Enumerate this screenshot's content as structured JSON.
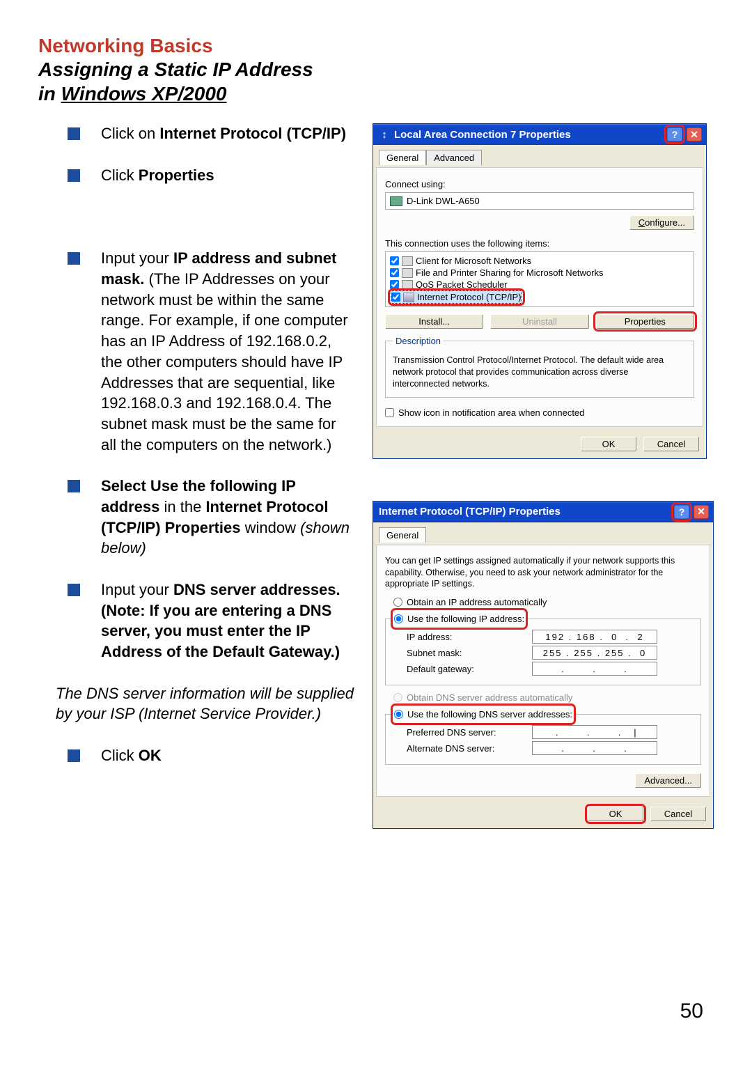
{
  "headings": {
    "red": "Networking Basics",
    "black_line1": "Assigning a Static IP Address",
    "black_line2_prefix": "in ",
    "black_line2_underlined": "Windows XP/2000"
  },
  "instructions": {
    "i1_a": "Click on ",
    "i1_b": "Internet Protocol (TCP/IP)",
    "i2_a": "Click ",
    "i2_b": "Properties",
    "i3_a": "Input your ",
    "i3_b": "IP address and subnet mask.",
    "i3_c": " (The IP Addresses on your network must be within the same range. For example, if one computer has an IP Address of 192.168.0.2, the other computers should have IP Addresses that are sequential, like 192.168.0.3 and 192.168.0.4. The subnet mask must be the same for all the computers on the network.)",
    "i4_a": "Select Use the following IP address",
    "i4_b": "  in the ",
    "i4_c": "Internet Protocol (TCP/IP) Properties",
    "i4_d": " window ",
    "i4_e": "(shown below)",
    "i5_a": "Input your ",
    "i5_b": "DNS server addresses. (Note:  If you are entering a DNS server, you must enter the IP Address of the Default Gateway.)",
    "i6_a": "Click ",
    "i6_b": "OK"
  },
  "isp_note": "The DNS server information will be supplied by your ISP (Internet Service Provider.)",
  "page_number": "50",
  "dialog1": {
    "title": "Local Area Connection 7 Properties",
    "tabs": [
      "General",
      "Advanced"
    ],
    "connect_using_label": "Connect using:",
    "adapter": "D-Link DWL-A650",
    "configure_btn": "Configure...",
    "items_label": "This connection uses the following items:",
    "items": [
      "Client for Microsoft Networks",
      "File and Printer Sharing for Microsoft Networks",
      "QoS Packet Scheduler",
      "Internet Protocol (TCP/IP)"
    ],
    "install_btn": "Install...",
    "uninstall_btn": "Uninstall",
    "properties_btn": "Properties",
    "desc_legend": "Description",
    "desc_text": "Transmission Control Protocol/Internet Protocol. The default wide area network protocol that provides communication across diverse interconnected networks.",
    "show_icon": "Show icon in notification area when connected",
    "ok": "OK",
    "cancel": "Cancel"
  },
  "dialog2": {
    "title": "Internet Protocol (TCP/IP) Properties",
    "tab": "General",
    "note": "You can get IP settings assigned automatically if your network supports this capability. Otherwise, you need to ask your network administrator for the appropriate IP settings.",
    "r_obtain_ip": "Obtain an IP address automatically",
    "r_use_ip": "Use the following IP address:",
    "ip_label": "IP address:",
    "ip_value": "192 . 168 .  0  .  2",
    "subnet_label": "Subnet mask:",
    "subnet_value": "255 . 255 . 255 .  0",
    "gateway_label": "Default gateway:",
    "gateway_value": " .       .       . ",
    "r_obtain_dns": "Obtain DNS server address automatically",
    "r_use_dns": "Use the following DNS server addresses:",
    "pref_dns_label": "Preferred DNS server:",
    "pref_dns_value": " .       .       .   |",
    "alt_dns_label": "Alternate DNS server:",
    "alt_dns_value": " .       .       . ",
    "advanced_btn": "Advanced...",
    "ok": "OK",
    "cancel": "Cancel"
  }
}
